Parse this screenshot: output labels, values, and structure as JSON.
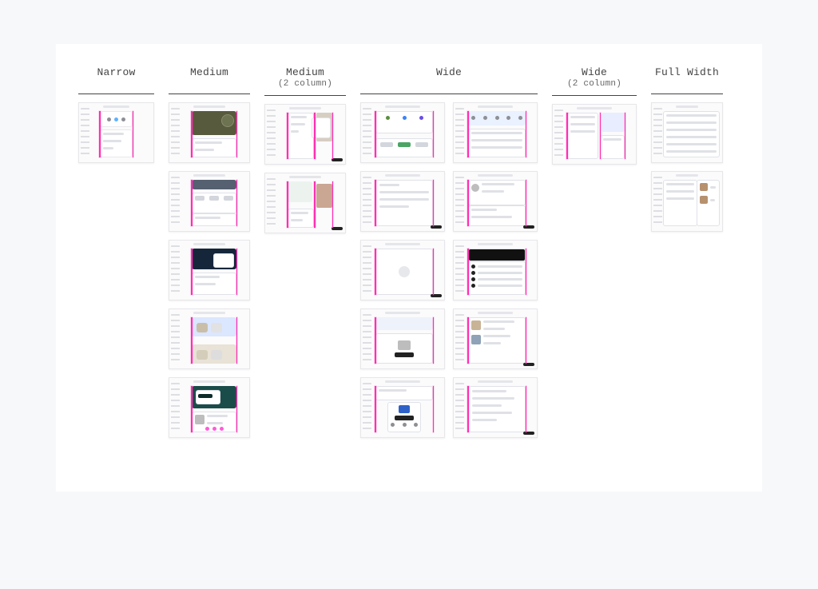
{
  "columns": [
    {
      "id": "narrow",
      "label": "Narrow",
      "sublabel": ""
    },
    {
      "id": "medium",
      "label": "Medium",
      "sublabel": ""
    },
    {
      "id": "medium2",
      "label": "Medium",
      "sublabel": "(2 column)"
    },
    {
      "id": "wide",
      "label": "Wide",
      "sublabel": ""
    },
    {
      "id": "wide2",
      "label": "Wide",
      "sublabel": "(2 column)"
    },
    {
      "id": "full",
      "label": "Full Width",
      "sublabel": ""
    }
  ],
  "thumb_counts": {
    "narrow": 1,
    "medium": 5,
    "medium2": 2,
    "wide_pairs": 5,
    "wide2": 1,
    "full": 2
  },
  "guide_color": "#ff2fb3"
}
